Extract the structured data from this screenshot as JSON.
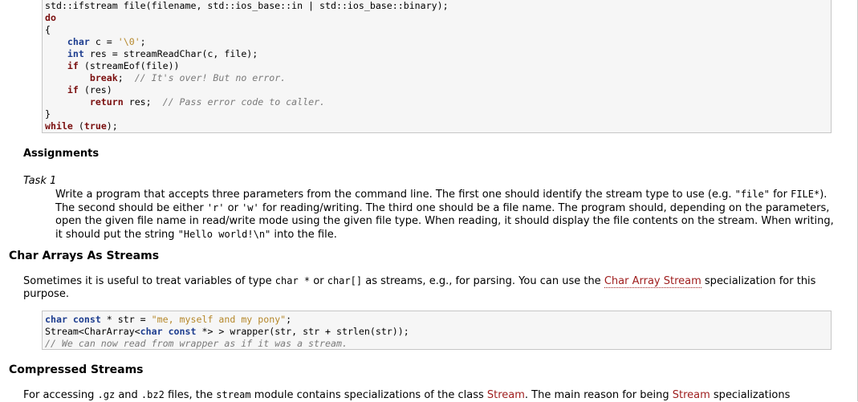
{
  "code_block_1": {
    "lines": [
      "std::ifstream file(filename, std::ios_base::in | std::ios_base::binary);",
      "do",
      "{",
      "    char c = '\\0';",
      "    int res = streamReadChar(c, file);",
      "    if (streamEof(file))",
      "        break;  // It's over! But no error.",
      "    if (res)",
      "        return res;  // Pass error code to caller.",
      "}",
      "while (true);"
    ]
  },
  "assignments": {
    "heading": "Assignments",
    "task_label": "Task 1",
    "task": {
      "t1": "Write a program that accepts three parameters from the command line. The first one should identify the stream type to use (e.g. ",
      "c1": "\"file\"",
      "t2": " for ",
      "c2": "FILE*",
      "t3": "). The second should be either ",
      "c3": "'r'",
      "t4": " or ",
      "c4": "'w'",
      "t5": " for reading/writing. The third one should be a file name. The program should, depending on the parameters, open the given file name in read/write mode using the given file type. When reading, it should display the file contents on the stream. When writing, it should put the string ",
      "c5": "\"Hello world!\\n\"",
      "t6": " into the file."
    }
  },
  "char_arrays": {
    "heading": "Char Arrays As Streams",
    "para": {
      "t1": "Sometimes it is useful to treat variables of type ",
      "c1": "char *",
      "t2": " or ",
      "c2": "char[]",
      "t3": " as streams, e.g., for parsing. You can use the ",
      "link": "Char Array Stream",
      "t4": " specialization for this purpose."
    }
  },
  "code_block_2": {
    "lines": [
      "char const * str = \"me, myself and my pony\";",
      "Stream<CharArray<char const *> > wrapper(str, str + strlen(str));",
      "// We can now read from wrapper as if it was a stream."
    ]
  },
  "compressed": {
    "heading": "Compressed Streams",
    "para": {
      "t1": "For accessing ",
      "c1": ".gz",
      "t2": " and ",
      "c2": ".bz2",
      "t3": " files, the ",
      "c3": "stream",
      "t4": " module contains specializations of the class ",
      "link1": "Stream",
      "t5": ". The main reason for being ",
      "link2": "Stream",
      "t6": " specializations"
    }
  }
}
